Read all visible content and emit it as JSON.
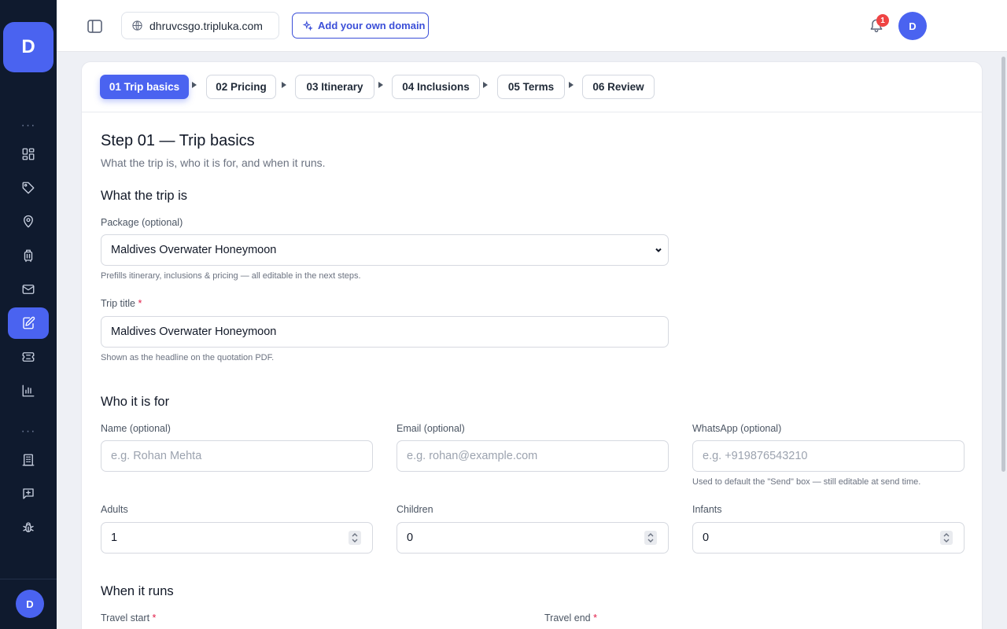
{
  "sidebar": {
    "brand_letter": "D",
    "more_1": "···",
    "more_2": "···",
    "items": [
      {
        "icon": "dashboard-icon"
      },
      {
        "icon": "tag-icon"
      },
      {
        "icon": "map-pin-icon"
      },
      {
        "icon": "luggage-icon"
      },
      {
        "icon": "mail-icon"
      },
      {
        "icon": "edit-quote-icon",
        "active": true
      },
      {
        "icon": "ticket-icon"
      },
      {
        "icon": "bar-chart-icon"
      },
      {
        "icon": "building-icon"
      },
      {
        "icon": "message-plus-icon"
      },
      {
        "icon": "bug-icon"
      }
    ],
    "avatar_letter": "D"
  },
  "topbar": {
    "domain": "dhruvcsgo.tripluka.com",
    "add_domain_label": "Add your own domain",
    "notification_count": "1",
    "avatar_letter": "D"
  },
  "stepper": {
    "steps": [
      {
        "label": "01 Trip basics",
        "active": true
      },
      {
        "label": "02 Pricing"
      },
      {
        "label": "03 Itinerary"
      },
      {
        "label": "04 Inclusions"
      },
      {
        "label": "05 Terms"
      },
      {
        "label": "06 Review"
      }
    ]
  },
  "form": {
    "title": "Step 01 — Trip basics",
    "subtitle": "What the trip is, who it is for, and when it runs.",
    "section_what": "What the trip is",
    "package_label": "Package (optional)",
    "package_value": "Maldives Overwater Honeymoon",
    "package_hint": "Prefills itinerary, inclusions & pricing — all editable in the next steps.",
    "trip_title_label": "Trip title",
    "required_mark": "*",
    "trip_title_value": "Maldives Overwater Honeymoon",
    "trip_title_hint": "Shown as the headline on the quotation PDF.",
    "section_who": "Who it is for",
    "name_label": "Name (optional)",
    "name_placeholder": "e.g. Rohan Mehta",
    "email_label": "Email (optional)",
    "email_placeholder": "e.g. rohan@example.com",
    "whatsapp_label": "WhatsApp (optional)",
    "whatsapp_placeholder": "e.g. +919876543210",
    "whatsapp_hint": "Used to default the \"Send\" box — still editable at send time.",
    "adults_label": "Adults",
    "adults_value": "1",
    "children_label": "Children",
    "children_value": "0",
    "infants_label": "Infants",
    "infants_value": "0",
    "section_when": "When it runs",
    "travel_start_label": "Travel start",
    "travel_end_label": "Travel end"
  },
  "colors": {
    "accent": "#4a63f0",
    "sidebar_bg": "#0f1a2e",
    "required": "#e11d48",
    "badge": "#ef4444"
  }
}
